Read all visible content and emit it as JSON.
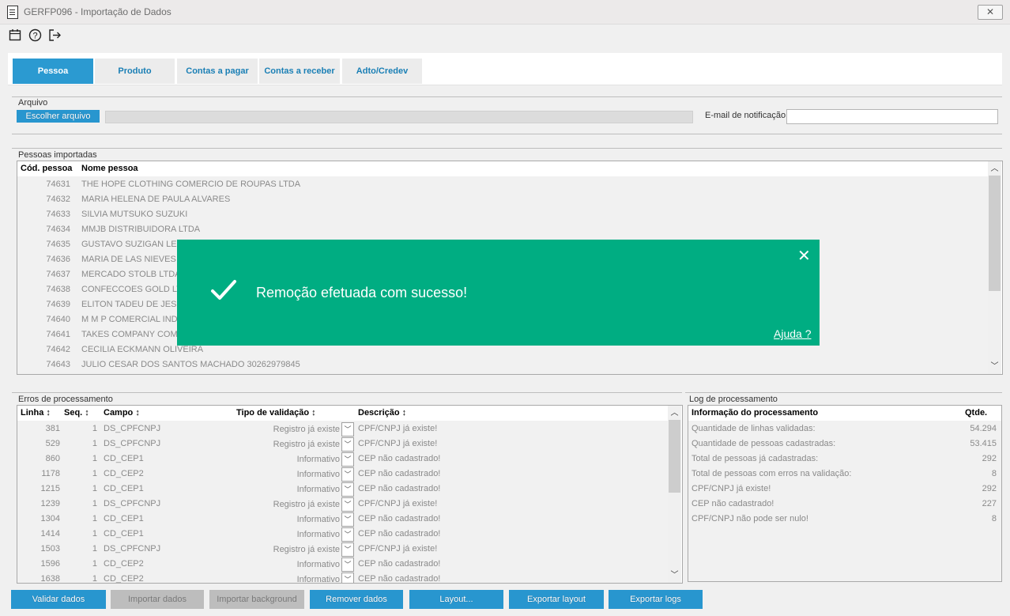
{
  "window": {
    "title": "GERFP096 - Importação de Dados",
    "close_icon": "✕"
  },
  "toolbar": {
    "calendar_icon": "calendar-icon",
    "help_icon": "help-icon",
    "exit_icon": "exit-icon"
  },
  "tabs": [
    {
      "label": "Pessoa",
      "active": true
    },
    {
      "label": "Produto",
      "active": false
    },
    {
      "label": "Contas a pagar",
      "active": false
    },
    {
      "label": "Contas a receber",
      "active": false
    },
    {
      "label": "Adto/Credev",
      "active": false
    }
  ],
  "arquivo": {
    "title": "Arquivo",
    "choose_button": "Escolher arquivo",
    "email_label": "E-mail de notificação",
    "email_value": ""
  },
  "pessoas": {
    "title": "Pessoas importadas",
    "columns": [
      "Cód. pessoa",
      "Nome pessoa"
    ],
    "rows": [
      [
        "74631",
        "THE HOPE CLOTHING COMERCIO DE ROUPAS LTDA"
      ],
      [
        "74632",
        "MARIA HELENA DE PAULA ALVARES"
      ],
      [
        "74633",
        "SILVIA MUTSUKO SUZUKI"
      ],
      [
        "74634",
        "MMJB DISTRIBUIDORA LTDA"
      ],
      [
        "74635",
        "GUSTAVO SUZIGAN LEI"
      ],
      [
        "74636",
        "MARIA DE LAS NIEVES E"
      ],
      [
        "74637",
        "MERCADO STOLB LTDA"
      ],
      [
        "74638",
        "CONFECCOES GOLD LTI"
      ],
      [
        "74639",
        "ELITON TADEU DE JESUS"
      ],
      [
        "74640",
        "M M P COMERCIAL INDUS"
      ],
      [
        "74641",
        "TAKES COMPANY COME"
      ],
      [
        "74642",
        "CECILIA ECKMANN OLIVEIRA"
      ],
      [
        "74643",
        "JULIO CESAR DOS SANTOS MACHADO 30262979845"
      ]
    ]
  },
  "erros": {
    "title": "Erros de processamento",
    "columns": [
      "Linha ↕",
      "Seq. ↕",
      "Campo ↕",
      "Tipo de validação ↕",
      "Descrição ↕"
    ],
    "rows": [
      [
        "381",
        "1",
        "DS_CPFCNPJ",
        "Registro já existe",
        "CPF/CNPJ já existe!"
      ],
      [
        "529",
        "1",
        "DS_CPFCNPJ",
        "Registro já existe",
        "CPF/CNPJ já existe!"
      ],
      [
        "860",
        "1",
        "CD_CEP1",
        "Informativo",
        "CEP não cadastrado!"
      ],
      [
        "1178",
        "1",
        "CD_CEP2",
        "Informativo",
        "CEP não cadastrado!"
      ],
      [
        "1215",
        "1",
        "CD_CEP1",
        "Informativo",
        "CEP não cadastrado!"
      ],
      [
        "1239",
        "1",
        "DS_CPFCNPJ",
        "Registro já existe",
        "CPF/CNPJ já existe!"
      ],
      [
        "1304",
        "1",
        "CD_CEP1",
        "Informativo",
        "CEP não cadastrado!"
      ],
      [
        "1414",
        "1",
        "CD_CEP1",
        "Informativo",
        "CEP não cadastrado!"
      ],
      [
        "1503",
        "1",
        "DS_CPFCNPJ",
        "Registro já existe",
        "CPF/CNPJ já existe!"
      ],
      [
        "1596",
        "1",
        "CD_CEP2",
        "Informativo",
        "CEP não cadastrado!"
      ],
      [
        "1638",
        "1",
        "CD_CEP2",
        "Informativo",
        "CEP não cadastrado!"
      ]
    ]
  },
  "log": {
    "title": "Log de processamento",
    "columns": [
      "Informação do processamento",
      "Qtde."
    ],
    "rows": [
      [
        "Quantidade de linhas validadas:",
        "54.294"
      ],
      [
        "Quantidade de pessoas cadastradas:",
        "53.415"
      ],
      [
        "Total de pessoas já cadastradas:",
        "292"
      ],
      [
        "Total de pessoas com erros na validação:",
        "8"
      ],
      [
        "CPF/CNPJ já existe!",
        "292"
      ],
      [
        "CEP não cadastrado!",
        "227"
      ],
      [
        "CPF/CNPJ não pode ser nulo!",
        "8"
      ]
    ]
  },
  "toast": {
    "message": "Remoção efetuada com sucesso!",
    "help_link": "Ajuda ?",
    "close_icon": "✕",
    "color": "#00ad82"
  },
  "buttons": {
    "validar": "Validar dados",
    "importar": "Importar dados",
    "importar_bg": "Importar background",
    "remover": "Remover dados",
    "layout": "Layout...",
    "exportar_layout": "Exportar layout",
    "exportar_logs": "Exportar logs"
  },
  "colors": {
    "accent": "#2896cf",
    "active_tab": "#2b9ad1",
    "tab_text": "#1a7fb5"
  }
}
